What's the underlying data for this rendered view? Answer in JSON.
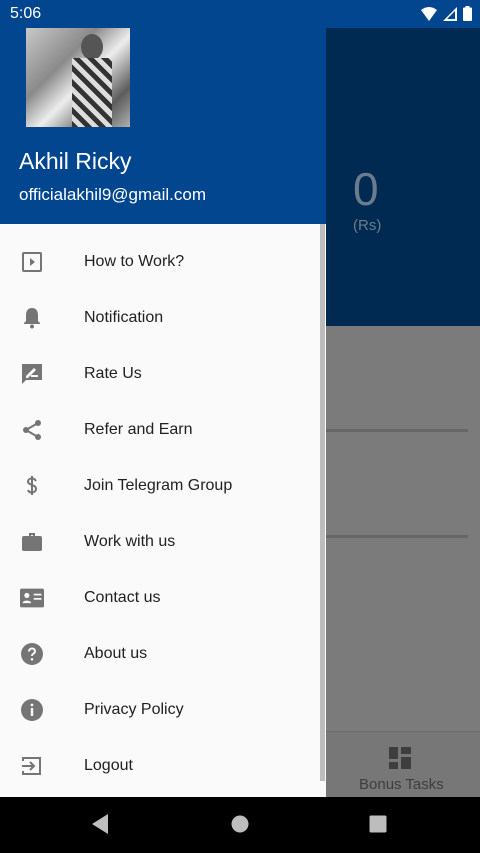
{
  "status_bar": {
    "time": "5:06"
  },
  "drawer": {
    "user_name": "Akhil Ricky",
    "user_email": "officialakhil9@gmail.com",
    "items": [
      {
        "label": "How to Work?",
        "icon": "play-box-icon"
      },
      {
        "label": "Notification",
        "icon": "bell-icon"
      },
      {
        "label": "Rate Us",
        "icon": "rate-review-icon"
      },
      {
        "label": "Refer and Earn",
        "icon": "share-icon"
      },
      {
        "label": "Join Telegram Group",
        "icon": "dollar-icon"
      },
      {
        "label": "Work with us",
        "icon": "briefcase-icon"
      },
      {
        "label": "Contact us",
        "icon": "contact-card-icon"
      },
      {
        "label": "About us",
        "icon": "help-circle-icon"
      },
      {
        "label": "Privacy Policy",
        "icon": "info-icon"
      },
      {
        "label": "Logout",
        "icon": "logout-icon"
      }
    ]
  },
  "app": {
    "balance_value": "0",
    "balance_unit": "(Rs)",
    "bottom_nav": {
      "bonus_label": "Bonus Tasks"
    }
  },
  "colors": {
    "primary": "#02468f",
    "scrim_dark": "#002a52",
    "drawer_bg": "#fafafa"
  }
}
